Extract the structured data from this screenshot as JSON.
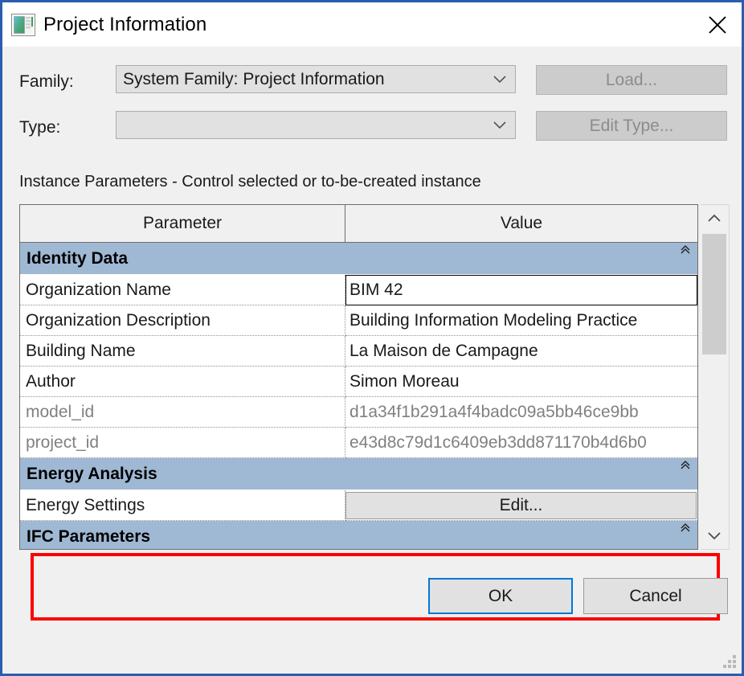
{
  "window": {
    "title": "Project Information",
    "icon": "project-information-icon",
    "close_icon": "close-icon",
    "border_color": "#2a5db0"
  },
  "form": {
    "family": {
      "label": "Family:",
      "value": "System Family: Project Information",
      "chevron_icon": "chevron-down-icon"
    },
    "type": {
      "label": "Type:",
      "value": "",
      "chevron_icon": "chevron-down-icon"
    },
    "load_button": "Load...",
    "edit_type_button": "Edit Type..."
  },
  "instance_caption": "Instance Parameters - Control selected or to-be-created instance",
  "grid": {
    "headers": {
      "parameter": "Parameter",
      "value": "Value"
    },
    "section_chevron_icon": "chevron-collapse-icon",
    "sections": [
      {
        "title": "Identity Data",
        "rows": [
          {
            "parameter": "Organization Name",
            "value": "BIM 42",
            "state": "active"
          },
          {
            "parameter": "Organization Description",
            "value": "Building Information Modeling Practice",
            "state": "normal"
          },
          {
            "parameter": "Building Name",
            "value": "La Maison de Campagne",
            "state": "normal"
          },
          {
            "parameter": "Author",
            "value": "Simon Moreau",
            "state": "normal"
          },
          {
            "parameter": "model_id",
            "value": "d1a34f1b291a4f4badc09a5bb46ce9bb",
            "state": "readonly"
          },
          {
            "parameter": "project_id",
            "value": "e43d8c79d1c6409eb3dd871170b4d6b0",
            "state": "readonly"
          }
        ]
      },
      {
        "title": "Energy Analysis",
        "rows": [
          {
            "parameter": "Energy Settings",
            "value": "Edit...",
            "state": "button"
          }
        ]
      },
      {
        "title": "IFC Parameters",
        "rows": []
      }
    ]
  },
  "scrollbar": {
    "up_icon": "chevron-up-icon",
    "down_icon": "chevron-down-icon",
    "thumb": "scroll-thumb"
  },
  "annotation": {
    "highlight_color": "#fb0000",
    "highlighted_parameters": [
      "model_id",
      "project_id"
    ]
  },
  "footer": {
    "ok_label": "OK",
    "cancel_label": "Cancel",
    "resize_grip": "resize-grip"
  }
}
